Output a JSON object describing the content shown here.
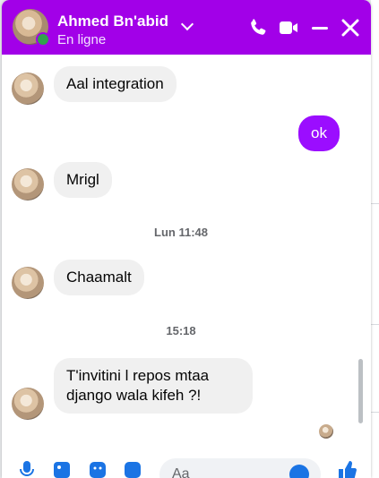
{
  "colors": {
    "header_bg": "#a200e8",
    "outgoing_bubble": "#9b0dff",
    "incoming_bubble": "#f0f0f0",
    "online": "#31a24c",
    "icon_blue": "#1b74e4"
  },
  "header": {
    "contact_name": "Ahmed Bn'abid",
    "status": "En ligne",
    "icons": [
      "phone-icon",
      "video-icon",
      "minimize-icon",
      "close-icon"
    ]
  },
  "messages": [
    {
      "type": "incoming",
      "text": "Aal integration"
    },
    {
      "type": "outgoing",
      "text": "ok"
    },
    {
      "type": "incoming",
      "text": "Mrigl"
    },
    {
      "type": "timestamp",
      "text": "Lun 11:48"
    },
    {
      "type": "incoming",
      "text": "Chaamalt"
    },
    {
      "type": "timestamp",
      "text": "15:18"
    },
    {
      "type": "incoming",
      "text": "T'invitini l repos mtaa django wala kifeh ?!"
    }
  ],
  "composer": {
    "placeholder": "Aa",
    "icons": [
      "mic-icon",
      "image-icon",
      "sticker-icon",
      "gif-icon",
      "emoji-icon",
      "like-icon"
    ]
  }
}
